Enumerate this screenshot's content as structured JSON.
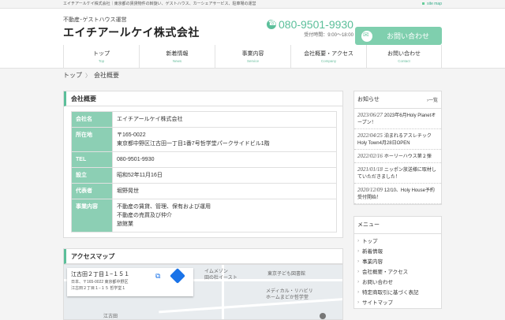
{
  "topbar": {
    "text": "エイチアールケイ株式会社｜東京都の賃貸物件の斡旋い、ゲストハウス、カーシェアサービス、駐車場の運営",
    "sitemap": "site map"
  },
  "header": {
    "tagline": "不動産･ゲストハウス運営",
    "logo": "エイチアールケイ株式会社",
    "phone": "080-9501-9930",
    "hours": "受付時間：9:00～18:00",
    "contact_label": "お問い合わせ"
  },
  "nav": [
    {
      "label": "トップ",
      "sub": "Top"
    },
    {
      "label": "新着情報",
      "sub": "News"
    },
    {
      "label": "事業内容",
      "sub": "Service"
    },
    {
      "label": "会社概要・アクセス",
      "sub": "Company"
    },
    {
      "label": "お問い合わせ",
      "sub": "Contact"
    }
  ],
  "breadcrumb": {
    "home": "トップ",
    "sep": "〉",
    "current": "会社概要"
  },
  "company": {
    "title": "会社概要",
    "rows": [
      {
        "key": "会社名",
        "lines": [
          "エイチアールケイ株式会社"
        ]
      },
      {
        "key": "所在地",
        "lines": [
          "〒165-0022",
          "東京都中野区江古田一丁目1番7号哲学堂パークサイドビル1階"
        ]
      },
      {
        "key": "TEL",
        "lines": [
          "080-9501-9930"
        ]
      },
      {
        "key": "設立",
        "lines": [
          "昭和52年11月16日"
        ]
      },
      {
        "key": "代表者",
        "lines": [
          "堀野晃世"
        ]
      },
      {
        "key": "事業内容",
        "lines": [
          "不動産の賃貸、管理、保有および運用",
          "不動産の売買及び仲介",
          "旅館業"
        ]
      }
    ]
  },
  "access": {
    "title": "アクセスマップ",
    "map_addr1": "江古田２丁目１−１５１",
    "map_addr2a": "日本、〒165-0022 東京都中野区",
    "map_addr2b": "江古田２丁目１−１５ 哲学堂１",
    "map_label1": "イムメゾン",
    "map_label2": "田の杜イースト",
    "map_label3": "東京子ども図書館",
    "map_label4": "メディカル・リハビリ",
    "map_label5": "ホームまどか哲学堂",
    "map_label6": "江古田"
  },
  "news": {
    "title": "お知らせ",
    "more": "一覧",
    "items": [
      {
        "date": "2023/06/27",
        "text": "2023年6月Holy Planetオープン！"
      },
      {
        "date": "2022/04/25",
        "text": "泊まれるアスレチックHoly Town4月28日OPEN"
      },
      {
        "date": "2022/02/16",
        "text": "ホーリーハウス第２弾"
      },
      {
        "date": "2021/01/18",
        "text": "ニッポン放送様に取材していただきました！"
      },
      {
        "date": "2020/12/09",
        "text": "12/10、Holy House予約受付開始！"
      }
    ]
  },
  "menu": {
    "title": "メニュー",
    "items": [
      "トップ",
      "新着情報",
      "事業内容",
      "会社概要・アクセス",
      "お問い合わせ",
      "特定商取引に基づく表記",
      "サイトマップ"
    ]
  }
}
